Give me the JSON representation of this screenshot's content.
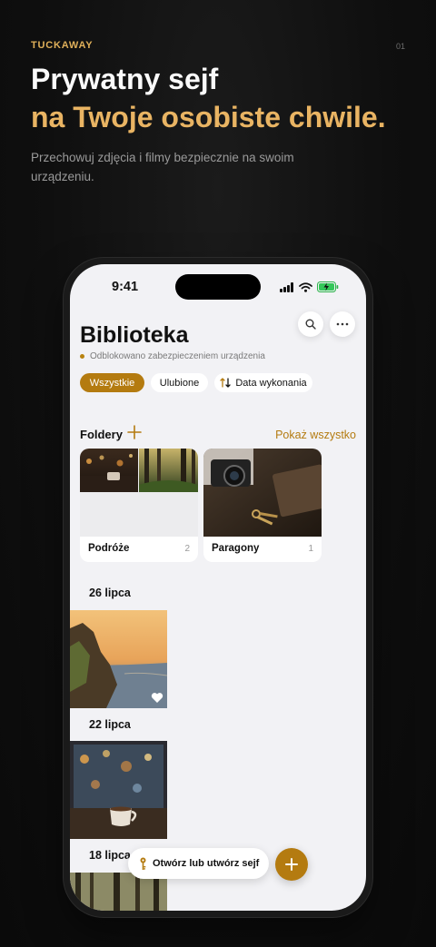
{
  "header": {
    "brand": "TUCKAWAY",
    "page_number": "01",
    "title_line1": "Prywatny sejf",
    "title_line2": "na Twoje osobiste chwile.",
    "subtitle": "Przechowuj zdjęcia i filmy bezpiecznie na swoim urządzeniu."
  },
  "status_bar": {
    "time": "9:41"
  },
  "app": {
    "title": "Biblioteka",
    "lock_status": "Odblokowano zabezpieczeniem urządzenia",
    "filters": [
      "Wszystkie",
      "Ulubione",
      "Data wykonania"
    ],
    "folders_title": "Foldery",
    "show_all": "Pokaż wszystko",
    "folders": [
      {
        "name": "Podróże",
        "count": "2"
      },
      {
        "name": "Paragony",
        "count": "1"
      }
    ],
    "dates": [
      "26 lipca",
      "22 lipca",
      "18 lipca"
    ],
    "open_vault": "Otwórz lub utwórz sejf"
  },
  "colors": {
    "accent": "#b47b10",
    "headline_accent": "#e9b463"
  }
}
